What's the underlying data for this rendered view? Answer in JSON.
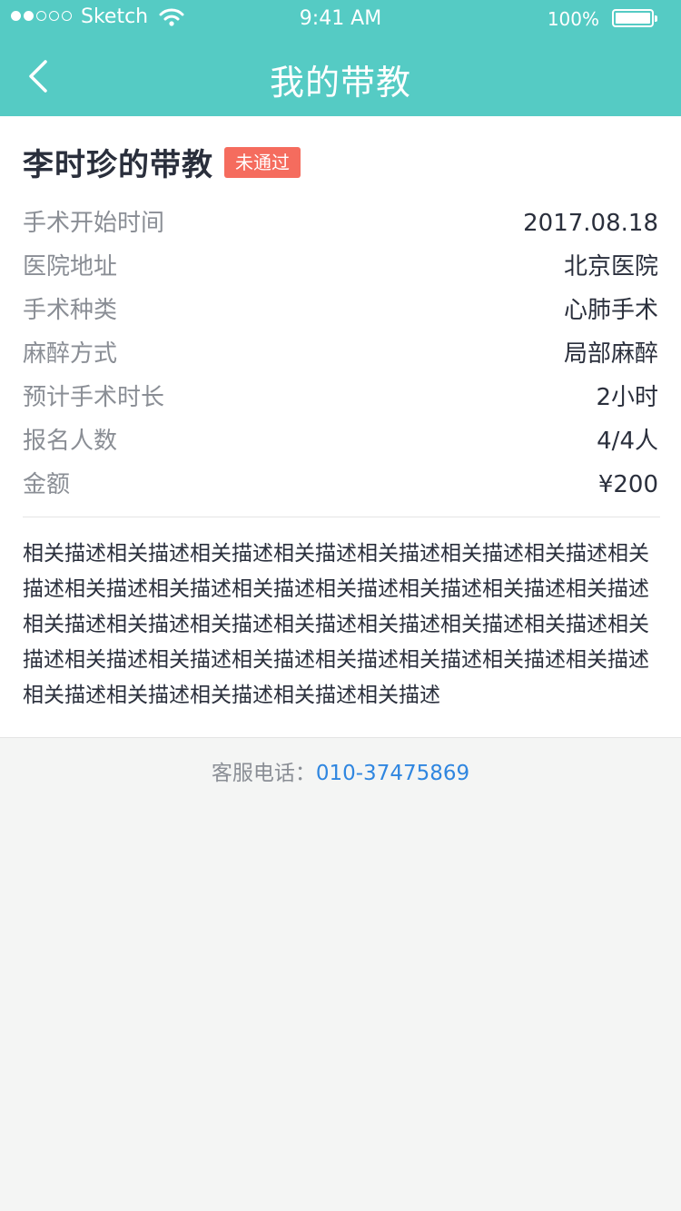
{
  "status_bar": {
    "carrier": "Sketch",
    "time": "9:41 AM",
    "battery": "100%"
  },
  "nav": {
    "title": "我的带教"
  },
  "detail": {
    "title": "李时珍的带教",
    "badge": "未通过",
    "fields": [
      {
        "label": "手术开始时间",
        "value": "2017.08.18"
      },
      {
        "label": "医院地址",
        "value": "北京医院"
      },
      {
        "label": "手术种类",
        "value": "心肺手术"
      },
      {
        "label": "麻醉方式",
        "value": "局部麻醉"
      },
      {
        "label": "预计手术时长",
        "value": "2小时"
      },
      {
        "label": "报名人数",
        "value": "4/4人"
      },
      {
        "label": "金额",
        "value": "¥200"
      }
    ],
    "description": "相关描述相关描述相关描述相关描述相关描述相关描述相关描述相关描述相关描述相关描述相关描述相关描述相关描述相关描述相关描述相关描述相关描述相关描述相关描述相关描述相关描述相关描述相关描述相关描述相关描述相关描述相关描述相关描述相关描述相关描述相关描述相关描述相关描述相关描述相关描述"
  },
  "service": {
    "label": "客服电话：",
    "phone": "010-37475869"
  },
  "colors": {
    "header": "#55cbc4",
    "badge": "#f56c5e",
    "link": "#2f86e0"
  }
}
